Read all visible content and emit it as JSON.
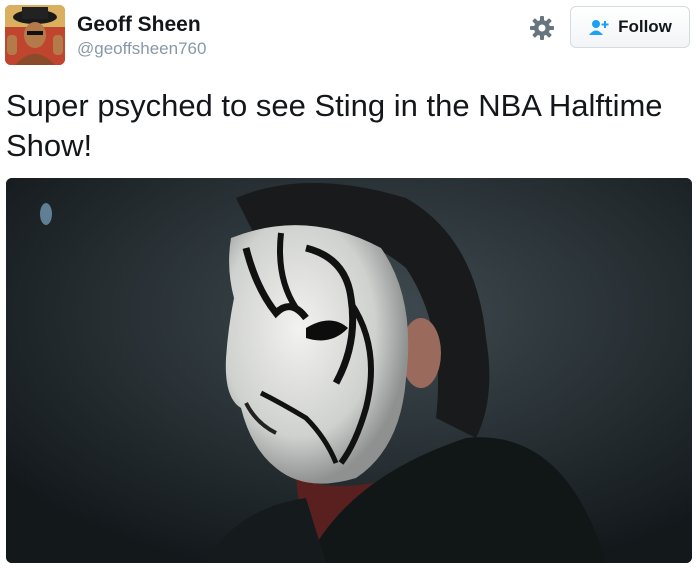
{
  "user": {
    "display_name": "Geoff Sheen",
    "handle": "@geoffsheen760"
  },
  "actions": {
    "follow_label": "Follow",
    "settings_icon": "gear-icon",
    "follow_icon": "add-user-icon"
  },
  "tweet": {
    "text": "Super psyched to see Sting in the NBA Halftime Show!"
  },
  "colors": {
    "name": "#14171a",
    "handle": "#8899a6",
    "button_border": "#d4dbe1",
    "follow_icon": "#1da1f2"
  }
}
